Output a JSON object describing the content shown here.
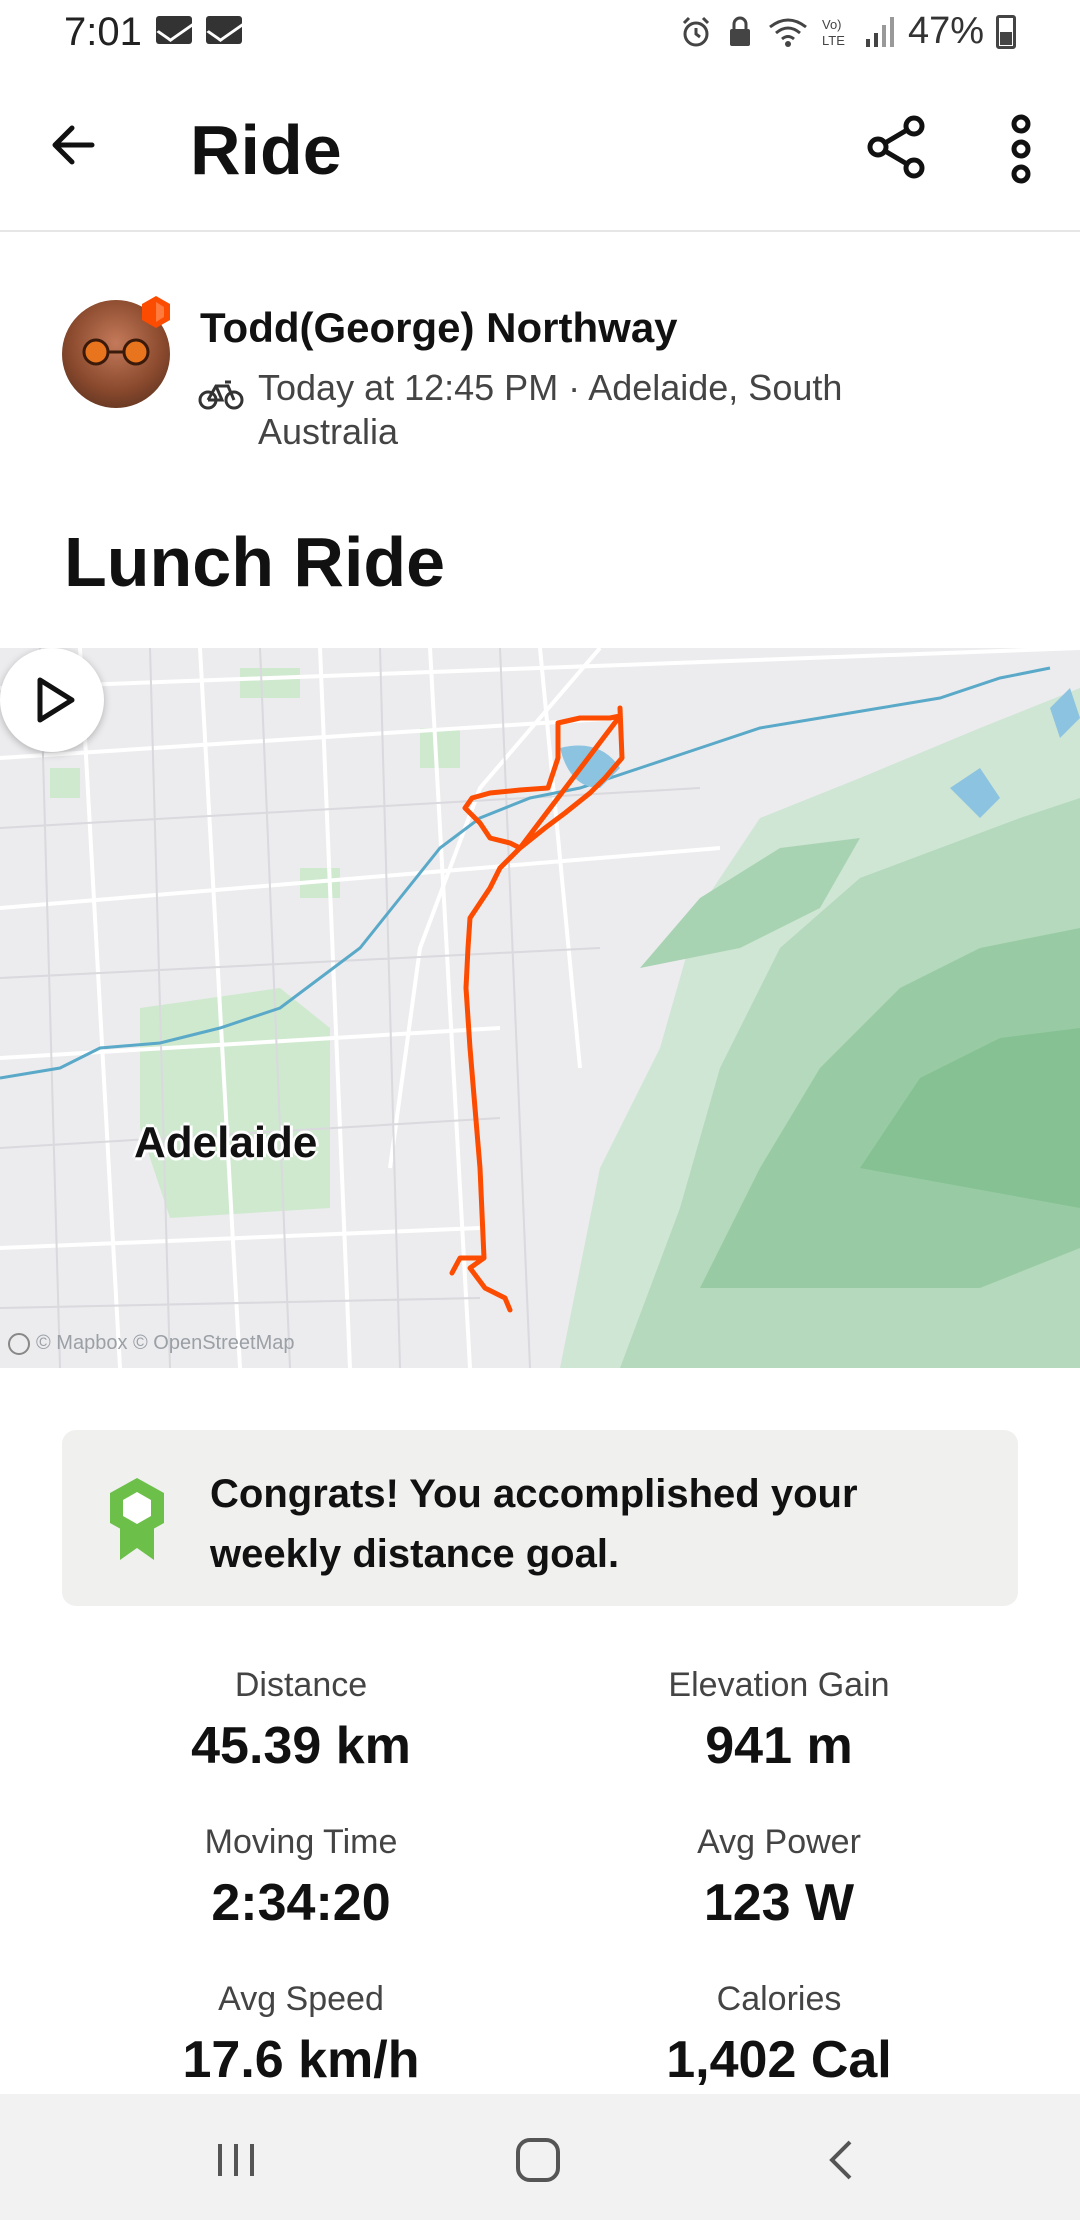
{
  "status_bar": {
    "time": "7:01",
    "battery_percent": "47%",
    "icons": [
      "mail-icon",
      "mail-icon",
      "alarm-icon",
      "lock-icon",
      "wifi-icon",
      "volte-icon",
      "signal-icon",
      "battery-icon"
    ]
  },
  "app_bar": {
    "title": "Ride",
    "back_icon": "arrow-left-icon",
    "share_icon": "share-icon",
    "more_icon": "more-vertical-icon"
  },
  "athlete": {
    "name": "Todd(George) Northway",
    "meta": "Today at 12:45 PM · Adelaide, South Australia",
    "activity_icon": "bike-icon"
  },
  "activity": {
    "title": "Lunch Ride"
  },
  "map": {
    "city_label": "Adelaide",
    "attribution": "© Mapbox © OpenStreetMap",
    "route_color": "#fc4c02",
    "play_icon": "play-icon"
  },
  "goal_banner": {
    "text": "Congrats! You accomplished your weekly distance goal.",
    "icon": "award-ribbon-icon",
    "icon_color": "#6cc04a"
  },
  "stats": [
    {
      "label": "Distance",
      "value": "45.39 km"
    },
    {
      "label": "Elevation Gain",
      "value": "941 m"
    },
    {
      "label": "Moving Time",
      "value": "2:34:20"
    },
    {
      "label": "Avg Power",
      "value": "123 W"
    },
    {
      "label": "Avg Speed",
      "value": "17.6 km/h"
    },
    {
      "label": "Calories",
      "value": "1,402 Cal"
    }
  ],
  "nav_bar": {
    "recents_icon": "recents-icon",
    "home_icon": "home-icon",
    "back_icon": "nav-back-icon"
  }
}
